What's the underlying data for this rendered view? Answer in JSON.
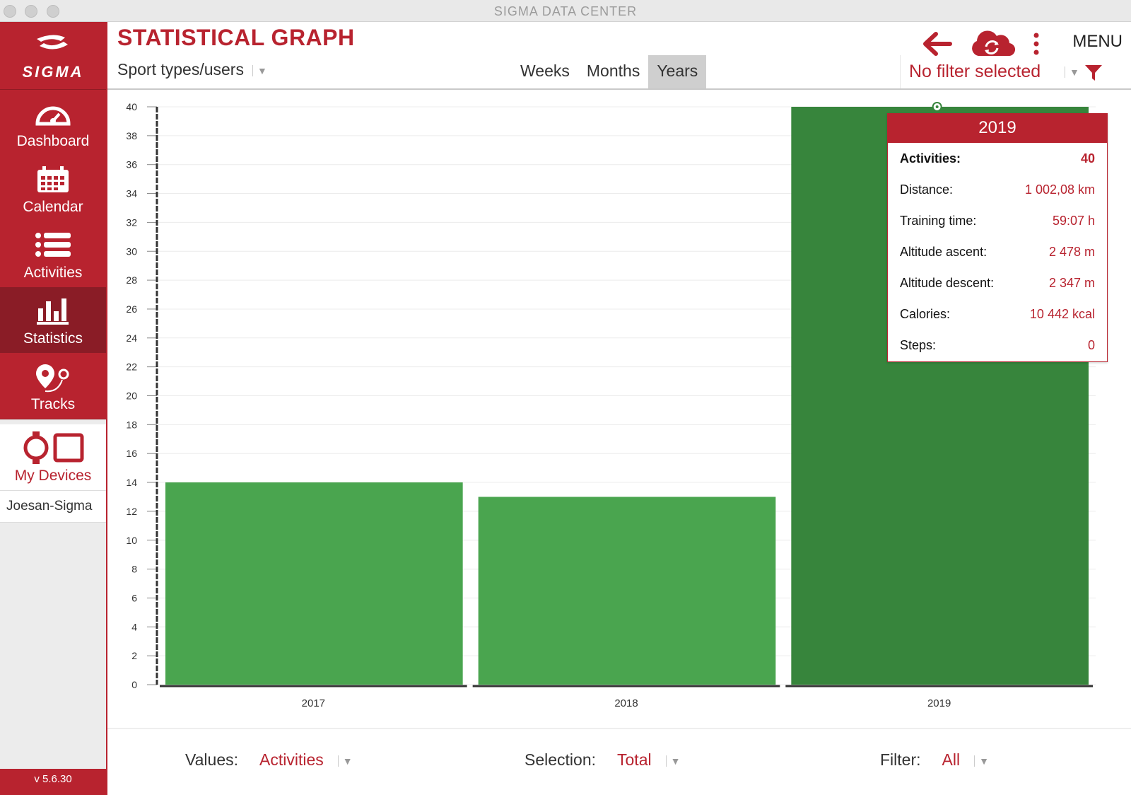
{
  "window": {
    "title": "SIGMA DATA CENTER"
  },
  "sidebar": {
    "logo_text": "SIGMA",
    "items": [
      {
        "label": "Dashboard",
        "icon": "dashboard-icon"
      },
      {
        "label": "Calendar",
        "icon": "calendar-icon"
      },
      {
        "label": "Activities",
        "icon": "list-icon"
      },
      {
        "label": "Statistics",
        "icon": "bar-chart-icon",
        "active": true
      },
      {
        "label": "Tracks",
        "icon": "map-pin-icon"
      }
    ],
    "devices_label": "My Devices",
    "user": "Joesan-Sigma",
    "version": "v 5.6.30"
  },
  "header": {
    "title": "STATISTICAL GRAPH",
    "sport_types": "Sport types/users",
    "tabs": [
      "Weeks",
      "Months",
      "Years"
    ],
    "active_tab": "Years",
    "menu_label": "MENU",
    "filter": "No filter selected"
  },
  "chart_data": {
    "type": "bar",
    "categories": [
      "2017",
      "2018",
      "2019"
    ],
    "values": [
      14,
      13,
      40
    ],
    "ylim": [
      0,
      40
    ],
    "yticks": [
      0,
      2,
      4,
      6,
      8,
      10,
      12,
      14,
      16,
      18,
      20,
      22,
      24,
      26,
      28,
      30,
      32,
      34,
      36,
      38,
      40
    ],
    "highlighted": "2019",
    "grid": true,
    "colors": {
      "bar": "#4aa54f",
      "highlight": "#37853c"
    }
  },
  "tooltip": {
    "title": "2019",
    "rows": [
      {
        "k": "Activities:",
        "v": "40"
      },
      {
        "k": "Distance:",
        "v": "1 002,08 km"
      },
      {
        "k": "Training time:",
        "v": "59:07 h"
      },
      {
        "k": "Altitude ascent:",
        "v": "2 478 m"
      },
      {
        "k": "Altitude descent:",
        "v": "2 347 m"
      },
      {
        "k": "Calories:",
        "v": "10 442 kcal"
      },
      {
        "k": "Steps:",
        "v": "0"
      }
    ]
  },
  "bottom": {
    "values_label": "Values:",
    "values_val": "Activities",
    "selection_label": "Selection:",
    "selection_val": "Total",
    "filter_label": "Filter:",
    "filter_val": "All"
  },
  "colors": {
    "brand": "#b8232f",
    "brand_dark": "#8a1c26"
  }
}
